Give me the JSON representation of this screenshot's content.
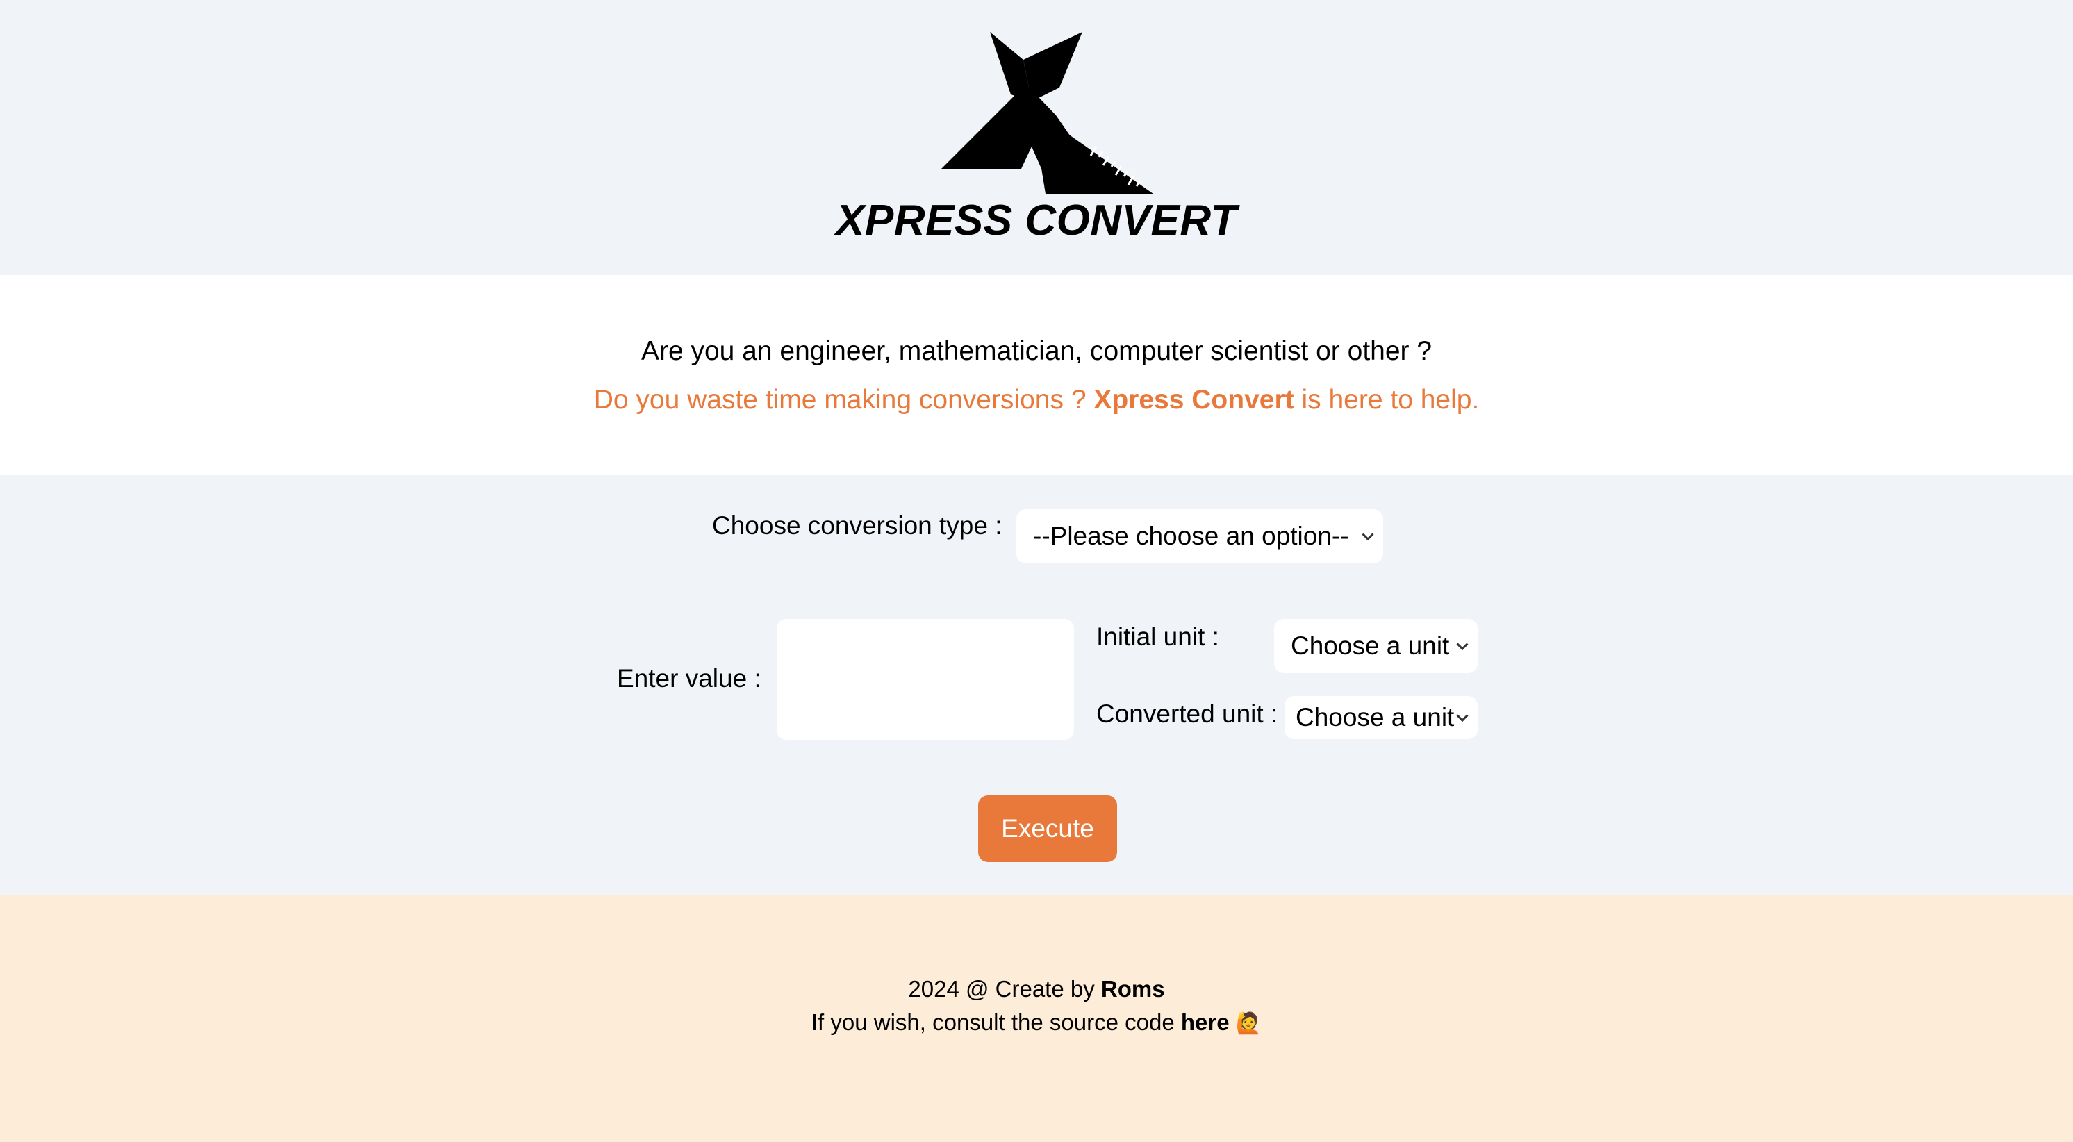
{
  "brand": {
    "name": "XPRESS CONVERT"
  },
  "intro": {
    "question": "Are you an engineer, mathematician, computer scientist or other ?",
    "pitch_before": "Do you waste time making conversions ? ",
    "pitch_brand": "Xpress Convert",
    "pitch_after": " is here to help."
  },
  "form": {
    "conversion_type_label": "Choose conversion type :",
    "conversion_type_selected": "--Please choose an option--",
    "enter_value_label": "Enter value :",
    "enter_value_value": "",
    "initial_unit_label": "Initial unit :",
    "initial_unit_selected": "Choose a unit",
    "converted_unit_label": "Converted unit :",
    "converted_unit_selected": "Choose a unit",
    "execute_label": "Execute"
  },
  "footer": {
    "credit_before": "2024 @ Create by ",
    "credit_author": "Roms",
    "source_before": "If you wish, consult the source code ",
    "source_link": "here",
    "source_emoji": "🙋"
  },
  "colors": {
    "accent": "#e8793a",
    "page_bg": "#f0f4f8",
    "footer_bg": "#fcecd8"
  },
  "icons": {
    "logo": "x-logo-icon",
    "chevron": "chevron-down-icon"
  }
}
